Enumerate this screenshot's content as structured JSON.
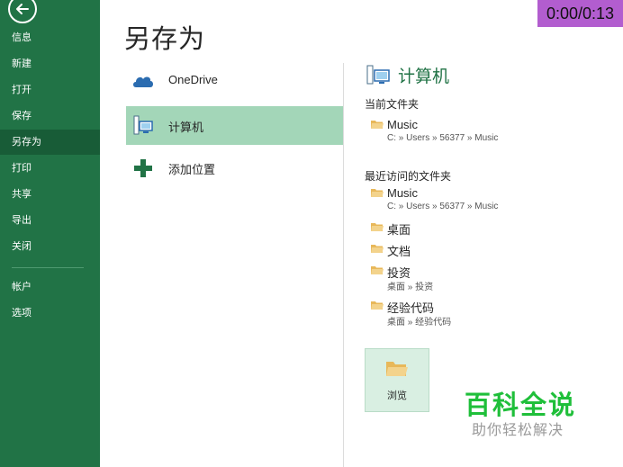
{
  "sidebar": {
    "items": [
      {
        "label": "信息"
      },
      {
        "label": "新建"
      },
      {
        "label": "打开"
      },
      {
        "label": "保存"
      },
      {
        "label": "另存为",
        "active": true
      },
      {
        "label": "打印"
      },
      {
        "label": "共享"
      },
      {
        "label": "导出"
      },
      {
        "label": "关闭"
      },
      {
        "label": "帐户"
      },
      {
        "label": "选项"
      }
    ]
  },
  "page_title": "另存为",
  "locations": [
    {
      "label": "OneDrive",
      "icon": "cloud-icon"
    },
    {
      "label": "计算机",
      "icon": "computer-icon",
      "active": true
    },
    {
      "label": "添加位置",
      "icon": "plus-icon"
    }
  ],
  "right": {
    "title": "计算机",
    "current_heading": "当前文件夹",
    "current_folder": {
      "name": "Music",
      "path": "C: » Users » 56377 » Music"
    },
    "recent_heading": "最近访问的文件夹",
    "recent_folders": [
      {
        "name": "Music",
        "path": "C: » Users » 56377 » Music"
      },
      {
        "name": "桌面",
        "path": ""
      },
      {
        "name": "文档",
        "path": ""
      },
      {
        "name": "投资",
        "path": "桌面 » 投资"
      },
      {
        "name": "经验代码",
        "path": "桌面 » 经验代码"
      }
    ],
    "browse_label": "浏览"
  },
  "timer": "0:00/0:13",
  "watermark": {
    "title": "百科全说",
    "subtitle": "助你轻松解决"
  },
  "colors": {
    "sidebar": "#217346",
    "sidebar_active": "#185c37",
    "selected_location": "#a3d6b8",
    "accent_green": "#217346",
    "timer_bg": "#b25dcf",
    "watermark_green": "#1fbf3a"
  }
}
